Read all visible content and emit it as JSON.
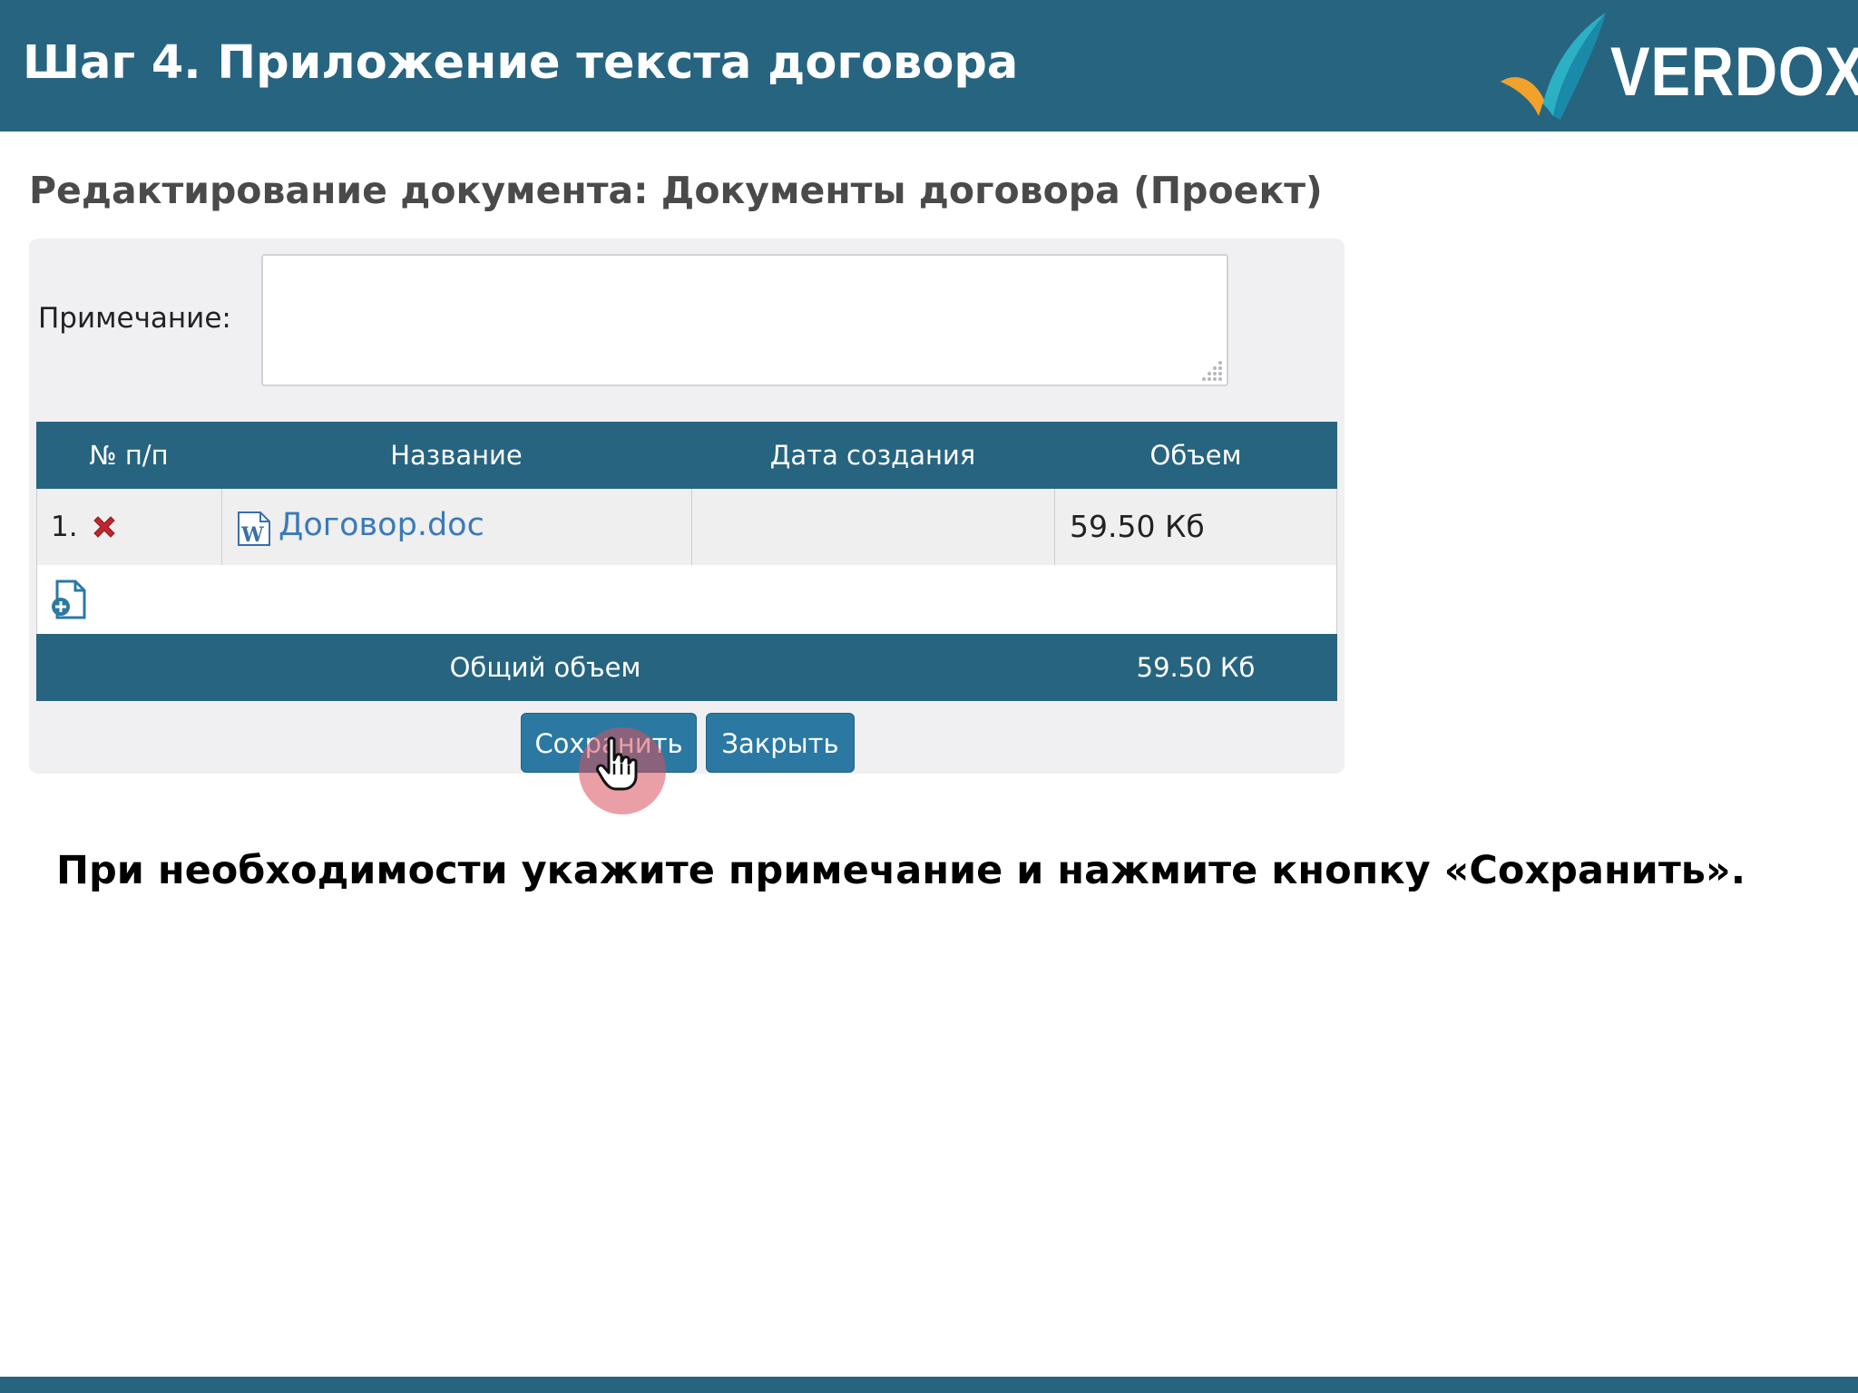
{
  "banner": {
    "title": "Шаг 4. Приложение текста договора",
    "logo_text": "VERDOX"
  },
  "heading": "Редактирование документа: Документы договора (Проект)",
  "form": {
    "note_label": "Примечание:",
    "note_value": ""
  },
  "table": {
    "headers": [
      "№ п/п",
      "Название",
      "Дата создания",
      "Объем"
    ],
    "rows": [
      {
        "number": "1.",
        "name": "Договор.doc",
        "created": "",
        "size": "59.50 Кб"
      }
    ],
    "footer": {
      "label": "Общий объем",
      "total": "59.50 Кб"
    }
  },
  "buttons": {
    "save": "Сохранить",
    "close": "Закрыть"
  },
  "instruction": "При необходимости укажите примечание и нажмите кнопку «Сохранить».",
  "colors": {
    "banner": "#276480",
    "button": "#2b79a3",
    "link": "#3a7ab8",
    "delete": "#c0282d",
    "click_halo": "#d8505c"
  },
  "icons": [
    "delete-icon",
    "word-doc-icon",
    "add-file-icon",
    "hand-pointer-icon",
    "resize-grip-icon"
  ]
}
